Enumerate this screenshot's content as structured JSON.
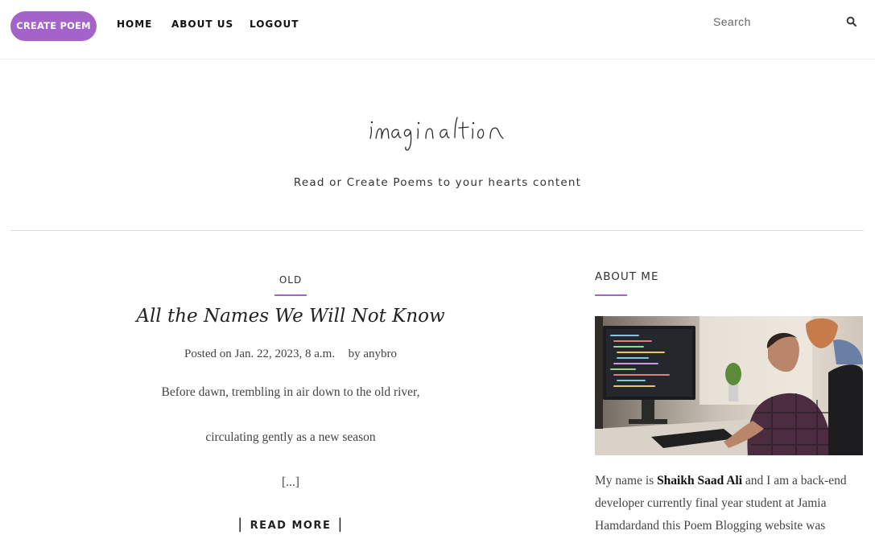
{
  "nav": {
    "create_label": "CREATE POEM",
    "links": [
      "HOME",
      "ABOUT US",
      "LOGOUT"
    ],
    "search_placeholder": "Search",
    "search_icon": "search-icon"
  },
  "header": {
    "logo_text": "imagination",
    "tagline": "Read or Create Poems to your hearts content"
  },
  "post": {
    "category": "OLD",
    "title": "All the Names We Will Not Know",
    "meta": {
      "posted_prefix": "Posted on",
      "date": "Jan. 22, 2023, 8 a.m.",
      "by_prefix": "by",
      "author": "anybro"
    },
    "excerpt": [
      "Before dawn, trembling in air down to the old river,",
      "circulating gently as a new season",
      "[...]"
    ],
    "read_more": "READ MORE"
  },
  "sidebar": {
    "about_title": "ABOUT ME",
    "about_intro": "My name is",
    "about_name": "Shaikh Saad Ali",
    "about_rest": "and I am a back-end developer currently final year student at Jamia Hamdardand this Poem Blogging website was"
  },
  "colors": {
    "accent": "#a463c9",
    "text": "#444444",
    "rule": "#dcdcdc"
  }
}
